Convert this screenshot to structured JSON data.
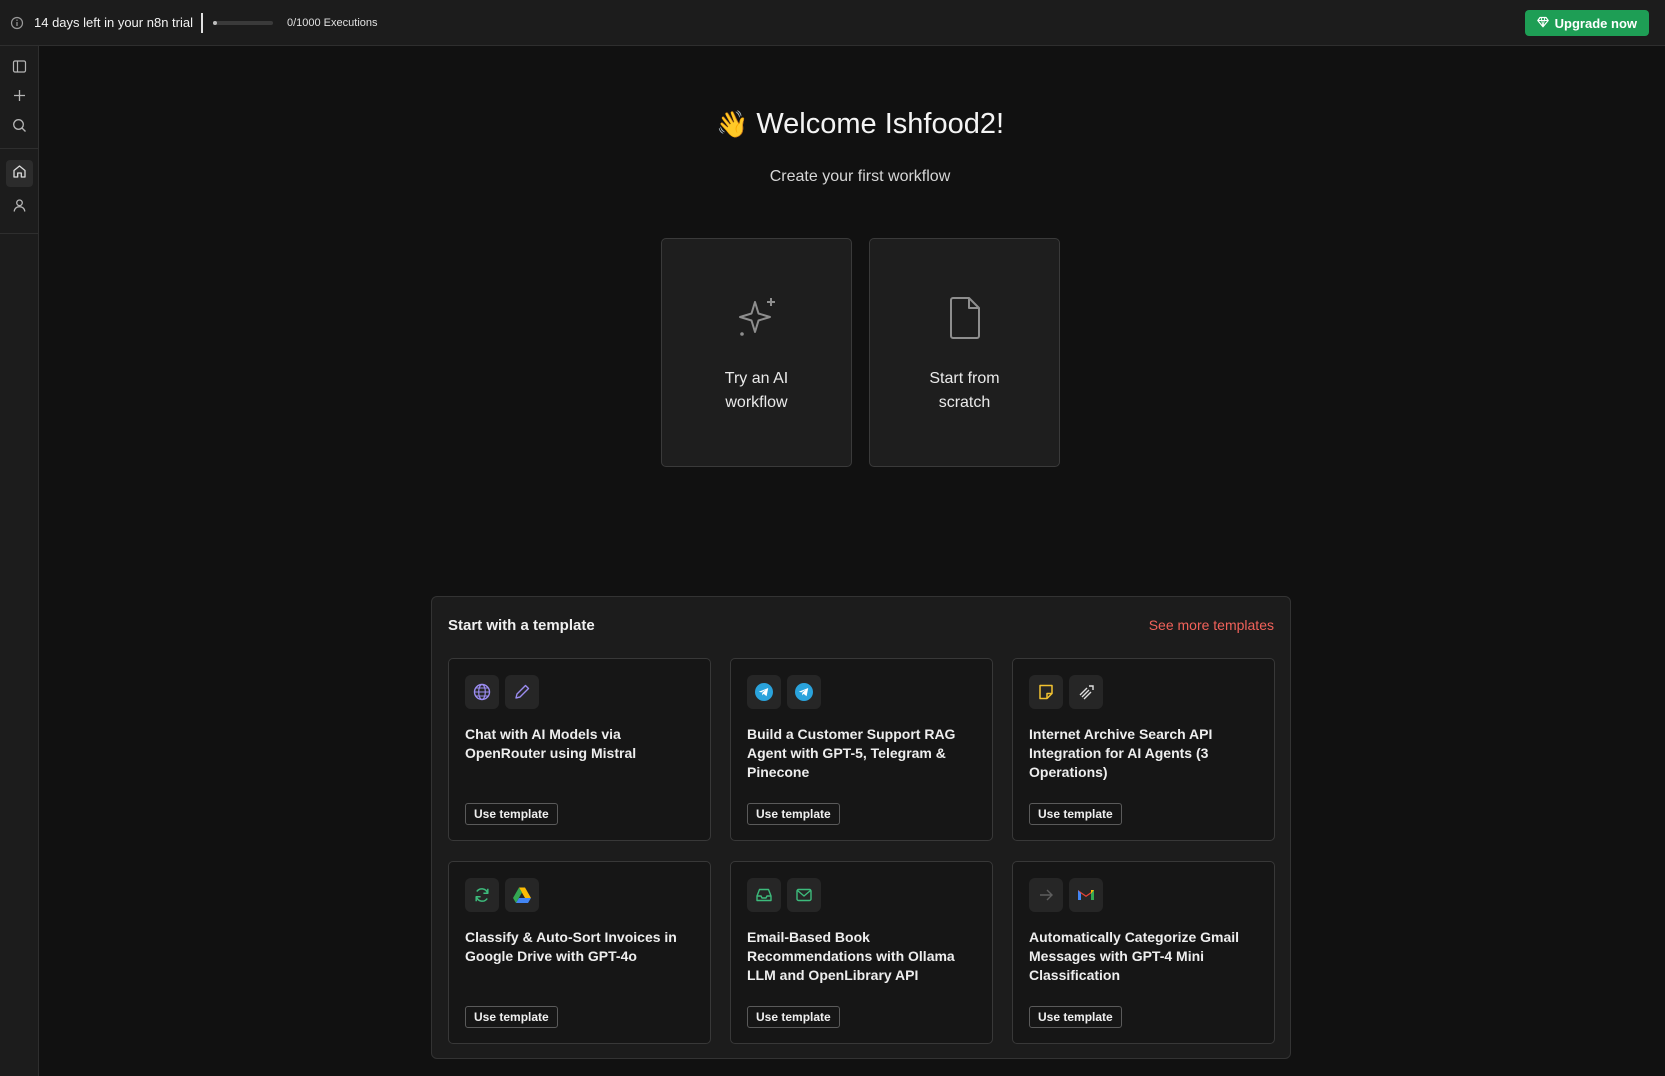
{
  "banner": {
    "trial_text": "14 days left in your n8n trial",
    "executions_used": 0,
    "executions_limit": 1000,
    "executions_text": "0/1000 Executions",
    "upgrade_label": "Upgrade now",
    "upgrade_color": "#1e9e55"
  },
  "sidebar": {
    "items": [
      {
        "icon": "panel-toggle-icon"
      },
      {
        "icon": "plus-icon"
      },
      {
        "icon": "search-icon"
      },
      {
        "icon": "home-icon",
        "active": true
      },
      {
        "icon": "user-icon"
      }
    ]
  },
  "welcome": {
    "emoji": "👋",
    "title": "Welcome Ishfood2!",
    "subtitle": "Create your first workflow"
  },
  "actions": [
    {
      "line1": "Try an AI",
      "line2": "workflow",
      "icon": "sparkles-icon"
    },
    {
      "line1": "Start from",
      "line2": "scratch",
      "icon": "file-icon"
    }
  ],
  "templates": {
    "title": "Start with a template",
    "see_more": "See more templates",
    "see_more_color": "#f2625a",
    "use_label": "Use template",
    "cards": [
      {
        "lines": [
          "Chat with AI Models via",
          "OpenRouter using Mistral"
        ],
        "icons": [
          "globe-icon",
          "pencil-icon"
        ]
      },
      {
        "lines": [
          "Build a Customer Support RAG",
          "Agent with GPT-5, Telegram &",
          "Pinecone"
        ],
        "icons": [
          "telegram-icon",
          "telegram-icon"
        ]
      },
      {
        "lines": [
          "Internet Archive Search API",
          "Integration for AI Agents (3",
          "Operations)"
        ],
        "icons": [
          "sticky-note-icon",
          "openrouter-icon"
        ]
      },
      {
        "lines": [
          "Classify & Auto-Sort Invoices in",
          "Google Drive with GPT-4o"
        ],
        "icons": [
          "refresh-icon",
          "google-drive-icon"
        ]
      },
      {
        "lines": [
          "Email-Based Book",
          "Recommendations with Ollama",
          "LLM and OpenLibrary API"
        ],
        "icons": [
          "inbox-icon",
          "mail-icon"
        ]
      },
      {
        "lines": [
          "Automatically Categorize Gmail",
          "Messages with GPT-4 Mini",
          "Classification"
        ],
        "icons": [
          "arrow-right-icon",
          "gmail-icon"
        ]
      }
    ]
  }
}
